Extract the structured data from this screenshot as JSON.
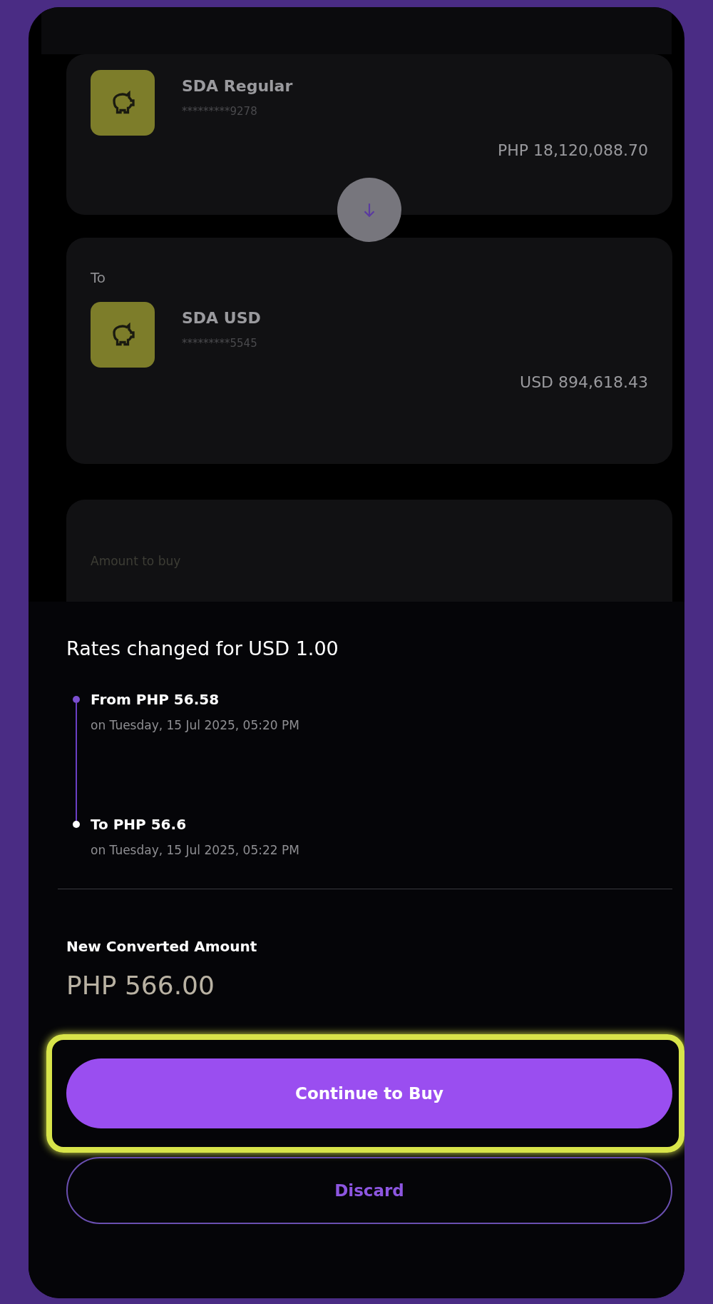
{
  "accounts": [
    {
      "name": "SDA Regular",
      "number": "*********9278",
      "balance": "PHP 18,120,088.70"
    },
    {
      "label": "To",
      "name": "SDA USD",
      "number": "*********5545",
      "balance": "USD 894,618.43"
    }
  ],
  "amount_card": {
    "label": "Amount to buy"
  },
  "sheet": {
    "title": "Rates changed for USD 1.00",
    "timeline": [
      {
        "title": "From PHP 56.58",
        "subtitle": "on Tuesday, 15 Jul 2025, 05:20 PM",
        "color": "#7b4fd0"
      },
      {
        "title": "To PHP 56.6",
        "subtitle": "on Tuesday, 15 Jul 2025, 05:22 PM",
        "color": "#ffffff"
      }
    ],
    "result_label": "New Converted Amount",
    "result_value": "PHP 566.00",
    "primary_button": {
      "label": "Continue to Buy",
      "highlighted": true
    },
    "secondary_button": {
      "label": "Discard"
    }
  }
}
